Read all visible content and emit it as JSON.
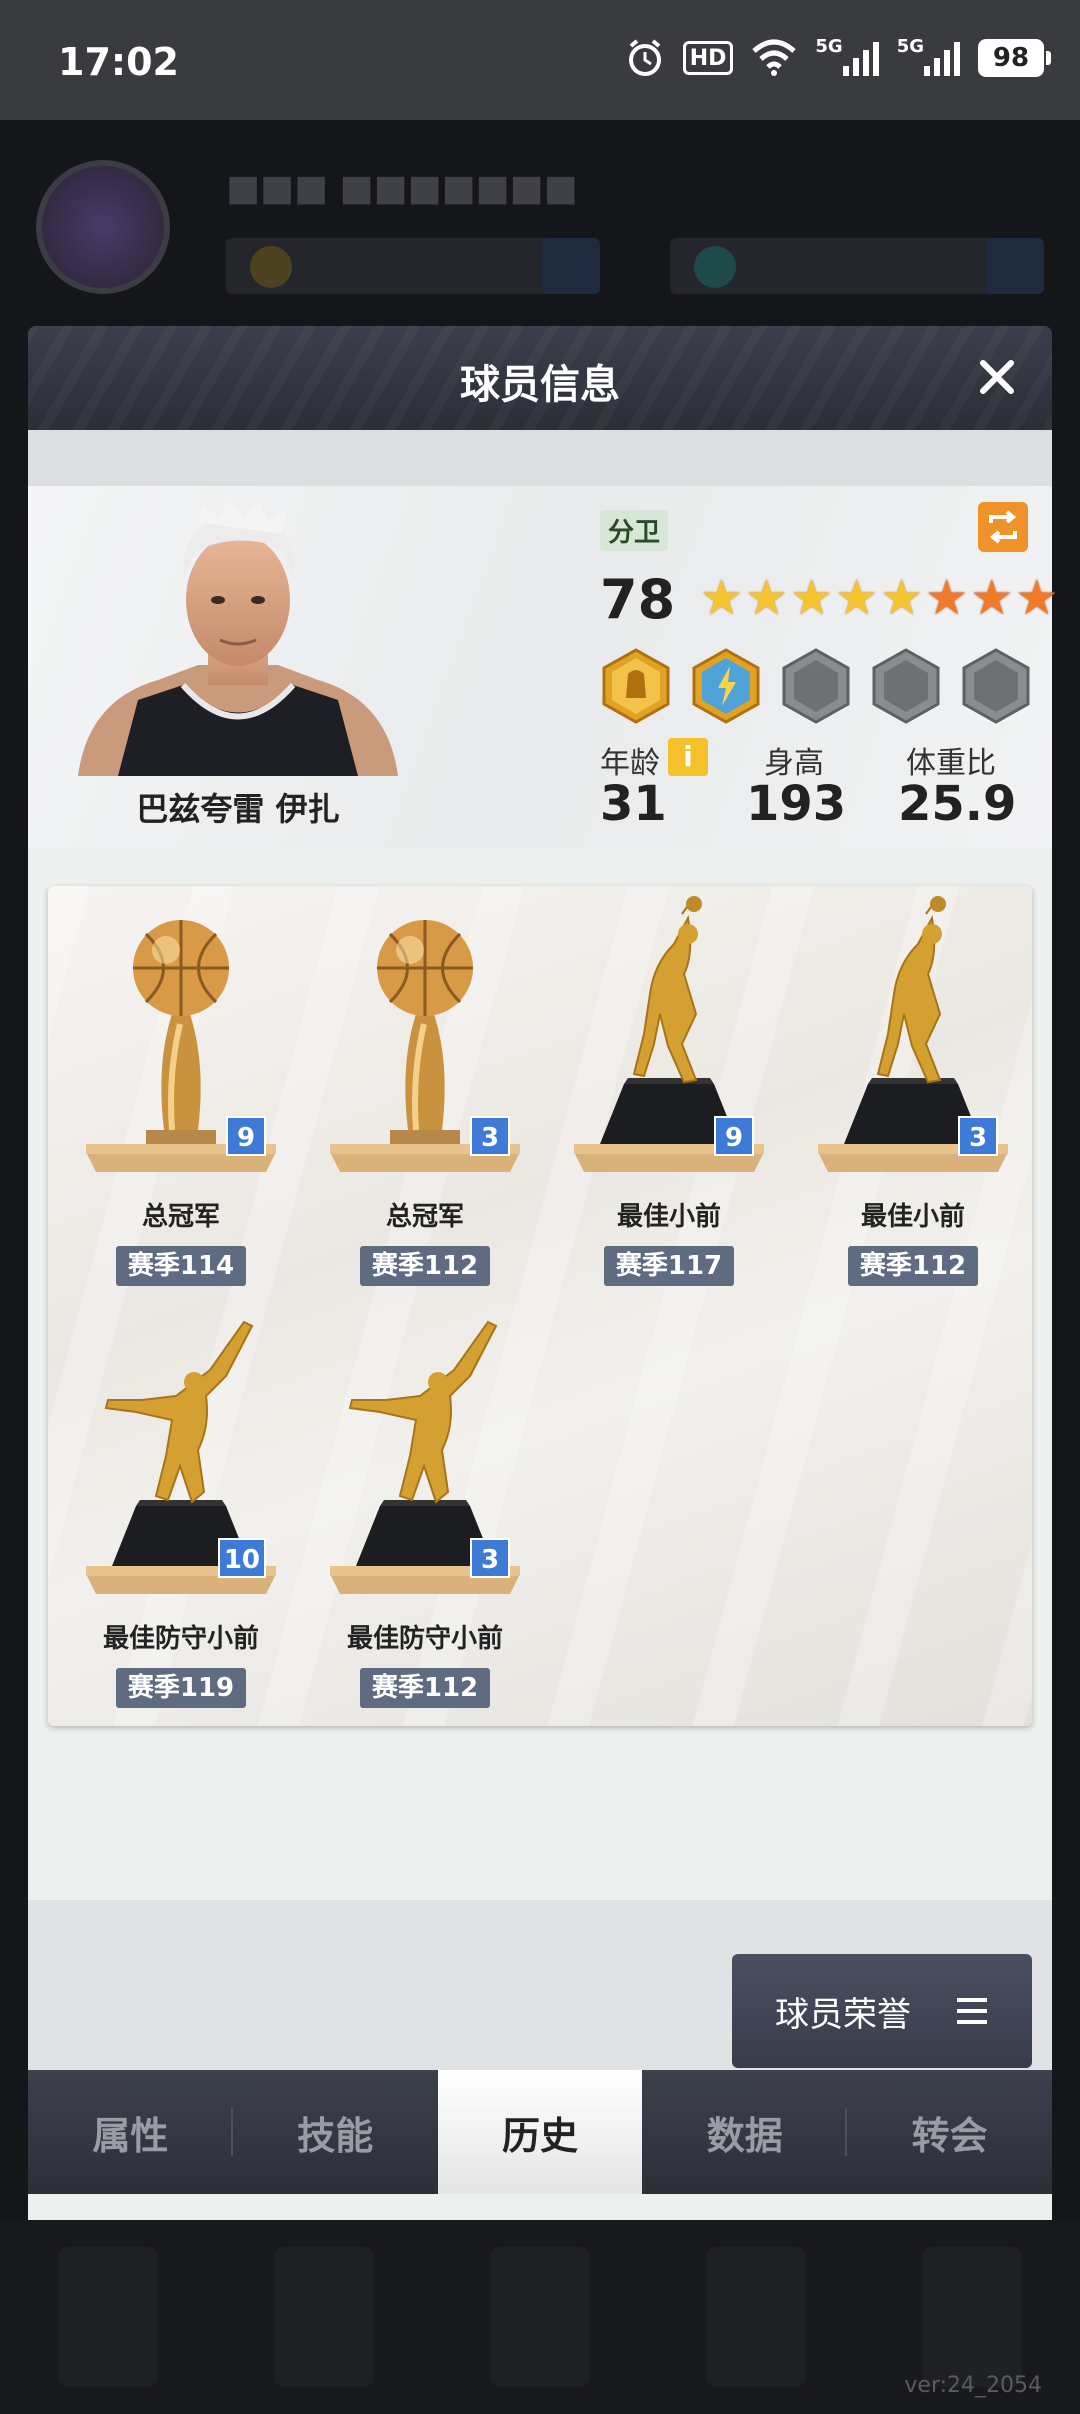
{
  "status_bar": {
    "time": "17:02",
    "hd_label": "HD",
    "net1": "5G",
    "net2": "5G",
    "battery": "98"
  },
  "modal": {
    "title": "球员信息"
  },
  "player": {
    "name": "巴兹夸雷 伊扎",
    "position": "分卫",
    "rating": "78",
    "stars_gold": 5,
    "stars_orange": 3,
    "age_label": "年龄",
    "age_value": "31",
    "height_label": "身高",
    "height_value": "193",
    "weight_ratio_label": "体重比",
    "weight_ratio_value": "25.9",
    "info_icon": "i"
  },
  "trophies": [
    {
      "type": "ball",
      "name": "总冠军",
      "season": "赛季114",
      "count": "9"
    },
    {
      "type": "ball",
      "name": "总冠军",
      "season": "赛季112",
      "count": "3"
    },
    {
      "type": "dunk",
      "name": "最佳小前",
      "season": "赛季117",
      "count": "9"
    },
    {
      "type": "dunk",
      "name": "最佳小前",
      "season": "赛季112",
      "count": "3"
    },
    {
      "type": "block",
      "name": "最佳防守小前",
      "season": "赛季119",
      "count": "10"
    },
    {
      "type": "block",
      "name": "最佳防守小前",
      "season": "赛季112",
      "count": "3"
    }
  ],
  "honor_button": {
    "label": "球员荣誉"
  },
  "tabs": [
    {
      "label": "属性",
      "active": false
    },
    {
      "label": "技能",
      "active": false
    },
    {
      "label": "历史",
      "active": true
    },
    {
      "label": "数据",
      "active": false
    },
    {
      "label": "转会",
      "active": false
    }
  ],
  "version": "ver:24_2054",
  "colors": {
    "accent_blue": "#3d7bd6",
    "season_tag": "#5e6b80",
    "swap_orange": "#f0922a",
    "star_gold": "#f5c430",
    "star_orange": "#f07a2a"
  }
}
